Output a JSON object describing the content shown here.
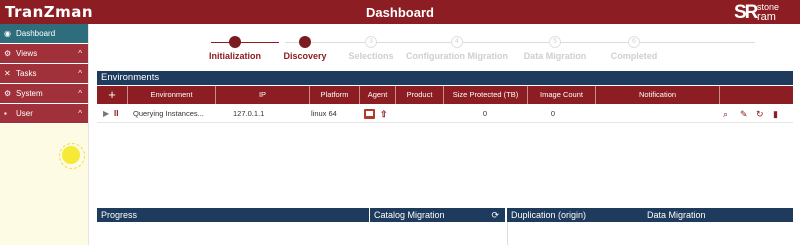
{
  "header": {
    "logo": "TranZman",
    "title": "Dashboard",
    "brand_mark": "SR",
    "brand_line1": "stone",
    "brand_line2": "ram"
  },
  "sidebar": {
    "items": [
      {
        "label": "Dashboard",
        "icon": "dashboard-icon",
        "active": true
      },
      {
        "label": "Views",
        "icon": "gear-icon"
      },
      {
        "label": "Tasks",
        "icon": "tasks-icon"
      },
      {
        "label": "System",
        "icon": "system-icon"
      },
      {
        "label": "User",
        "icon": "user-icon"
      }
    ]
  },
  "stepper": {
    "steps": [
      {
        "label": "Initialization",
        "status": "done"
      },
      {
        "label": "Discovery",
        "status": "done"
      },
      {
        "label": "Selections",
        "status": "todo",
        "num": "3"
      },
      {
        "label": "Configuration Migration",
        "status": "todo",
        "num": "4"
      },
      {
        "label": "Data Migration",
        "status": "todo",
        "num": "5"
      },
      {
        "label": "Completed",
        "status": "todo",
        "num": "6"
      }
    ]
  },
  "environments": {
    "title": "Environments",
    "add_label": "+",
    "columns": [
      "Environment",
      "IP",
      "Platform",
      "Agent",
      "Product",
      "Size Protected (TB)",
      "Image Count",
      "Notification"
    ],
    "rows": [
      {
        "play": "▶",
        "pause": "II",
        "environment": "Querying Instances...",
        "ip": "127.0.1.1",
        "platform": "linux 64",
        "agent": "",
        "product": "",
        "size": "0",
        "image_count": "0",
        "notification": ""
      }
    ]
  },
  "bottom": {
    "progress": "Progress",
    "catalog_migration": "Catalog Migration",
    "duplication": "Duplication (origin)",
    "data_migration": "Data Migration"
  },
  "colors": {
    "header": "#8c1d22",
    "panel": "#1e3a5c",
    "active_nav": "#2e6d7b",
    "nav": "#a03039",
    "sidebar_bg": "#fdfbe3"
  }
}
